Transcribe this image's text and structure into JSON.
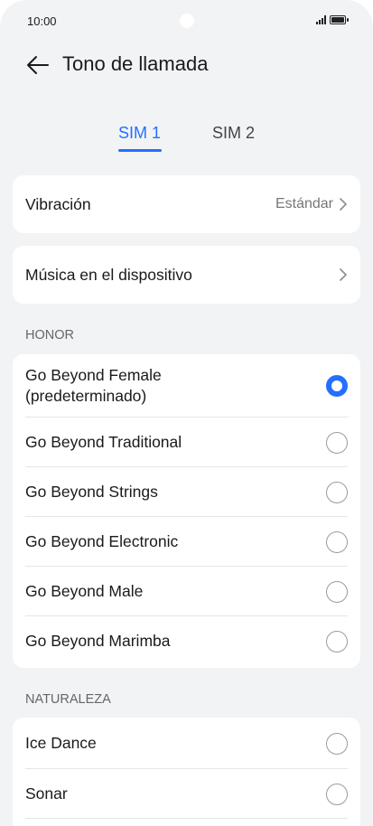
{
  "status_bar": {
    "time": "10:00"
  },
  "header": {
    "title": "Tono de llamada"
  },
  "tabs": [
    {
      "label": "SIM 1",
      "active": true
    },
    {
      "label": "SIM 2",
      "active": false
    }
  ],
  "vibration": {
    "label": "Vibración",
    "value": "Estándar"
  },
  "device_music": {
    "label": "Música en el dispositivo"
  },
  "honor_section": {
    "title": "HONOR",
    "items": [
      {
        "label": "Go Beyond Female\n(predeterminado)",
        "selected": true
      },
      {
        "label": "Go Beyond Traditional",
        "selected": false
      },
      {
        "label": "Go Beyond Strings",
        "selected": false
      },
      {
        "label": "Go Beyond Electronic",
        "selected": false
      },
      {
        "label": "Go Beyond Male",
        "selected": false
      },
      {
        "label": "Go Beyond Marimba",
        "selected": false
      }
    ]
  },
  "nature_section": {
    "title": "NATURALEZA",
    "items": [
      {
        "label": "Ice Dance",
        "selected": false
      },
      {
        "label": "Sonar",
        "selected": false
      }
    ]
  },
  "colors": {
    "accent": "#256fff",
    "background": "#f1f3f5"
  }
}
